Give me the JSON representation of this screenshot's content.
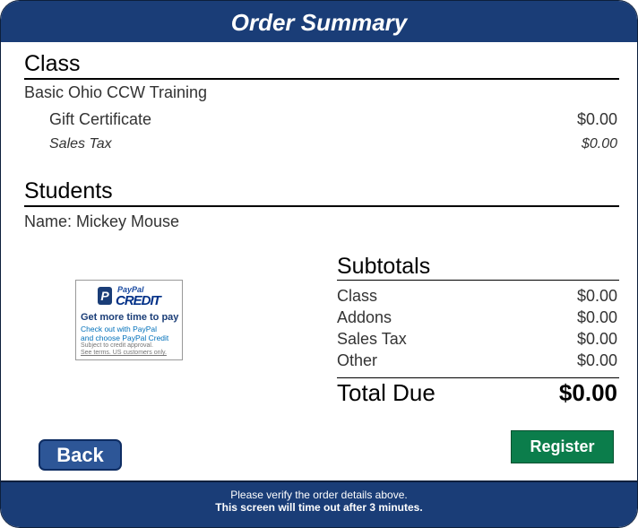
{
  "header": {
    "title": "Order Summary"
  },
  "class_section": {
    "title": "Class",
    "class_name": "Basic Ohio CCW Training",
    "items": [
      {
        "label": "Gift Certificate",
        "value": "$0.00"
      },
      {
        "label": "Sales Tax",
        "value": "$0.00"
      }
    ]
  },
  "students_section": {
    "title": "Students",
    "name_line": "Name: Mickey Mouse"
  },
  "paypal_ad": {
    "brand": "PayPal",
    "product": "CREDIT",
    "headline": "Get more time to pay",
    "line1": "Check out with PayPal",
    "line2": "and choose PayPal Credit",
    "fine1": "Subject to credit approval.",
    "fine2": "See terms. US customers only."
  },
  "subtotals": {
    "title": "Subtotals",
    "rows": [
      {
        "label": "Class",
        "value": "$0.00"
      },
      {
        "label": "Addons",
        "value": "$0.00"
      },
      {
        "label": "Sales Tax",
        "value": "$0.00"
      },
      {
        "label": "Other",
        "value": "$0.00"
      }
    ],
    "total_label": "Total Due",
    "total_value": "$0.00"
  },
  "buttons": {
    "back": "Back",
    "register": "Register"
  },
  "footer": {
    "line1": "Please verify the order details above.",
    "line2": "This screen will time out after 3 minutes."
  },
  "colors": {
    "header_blue": "#1a3d77",
    "register_green": "#0b7d4b",
    "back_blue": "#2d5697"
  }
}
